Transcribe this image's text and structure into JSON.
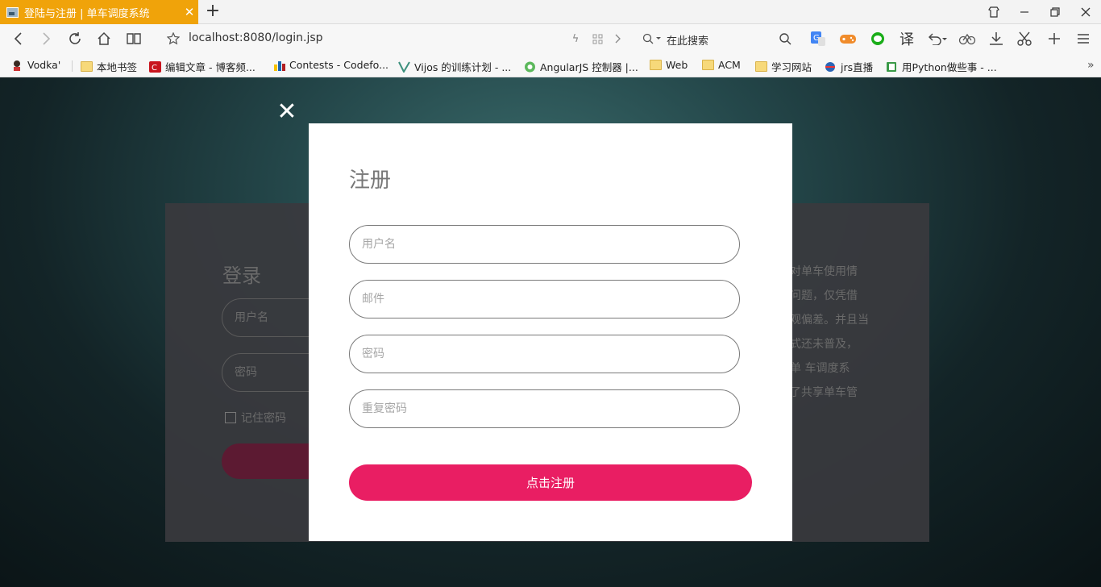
{
  "browser": {
    "tab_title": "登陆与注册 | 单车调度系统",
    "tab_close": "✕",
    "new_tab": "+",
    "url": "localhost:8080/login.jsp",
    "search_placeholder": "在此搜索"
  },
  "bookmarks": [
    {
      "label": "Vodka'",
      "icon": "avatar-icon"
    },
    {
      "label": "本地书签",
      "icon": "folder-icon"
    },
    {
      "label": "编辑文章 - 博客频...",
      "icon": "csdn-icon"
    },
    {
      "label": "Contests - Codefo...",
      "icon": "codeforces-icon"
    },
    {
      "label": "Vijos 的训练计划 - ...",
      "icon": "vijos-icon"
    },
    {
      "label": "AngularJS 控制器 |...",
      "icon": "angular-icon"
    },
    {
      "label": "Web",
      "icon": "folder-icon"
    },
    {
      "label": "ACM",
      "icon": "folder-icon"
    },
    {
      "label": "学习网站",
      "icon": "folder-icon"
    },
    {
      "label": "jrs直播",
      "icon": "jrs-icon"
    },
    {
      "label": "用Python做些事 - ...",
      "icon": "book-icon"
    }
  ],
  "login": {
    "title": "登录",
    "username_placeholder": "用户名",
    "password_placeholder": "密码",
    "remember": "记住密码",
    "intro_lines": [
      "对单车使用情",
      "问题，仅凭借",
      "观偏差。并且当",
      "式还未普及，",
      "单 车调度系",
      "了共享单车管"
    ]
  },
  "modal": {
    "close_label": "✕",
    "title": "注册",
    "username_placeholder": "用户名",
    "email_placeholder": "邮件",
    "password_placeholder": "密码",
    "confirm_placeholder": "重复密码",
    "submit_label": "点击注册"
  },
  "colors": {
    "accent": "#e91e63",
    "tab_active": "#f0a30a"
  }
}
